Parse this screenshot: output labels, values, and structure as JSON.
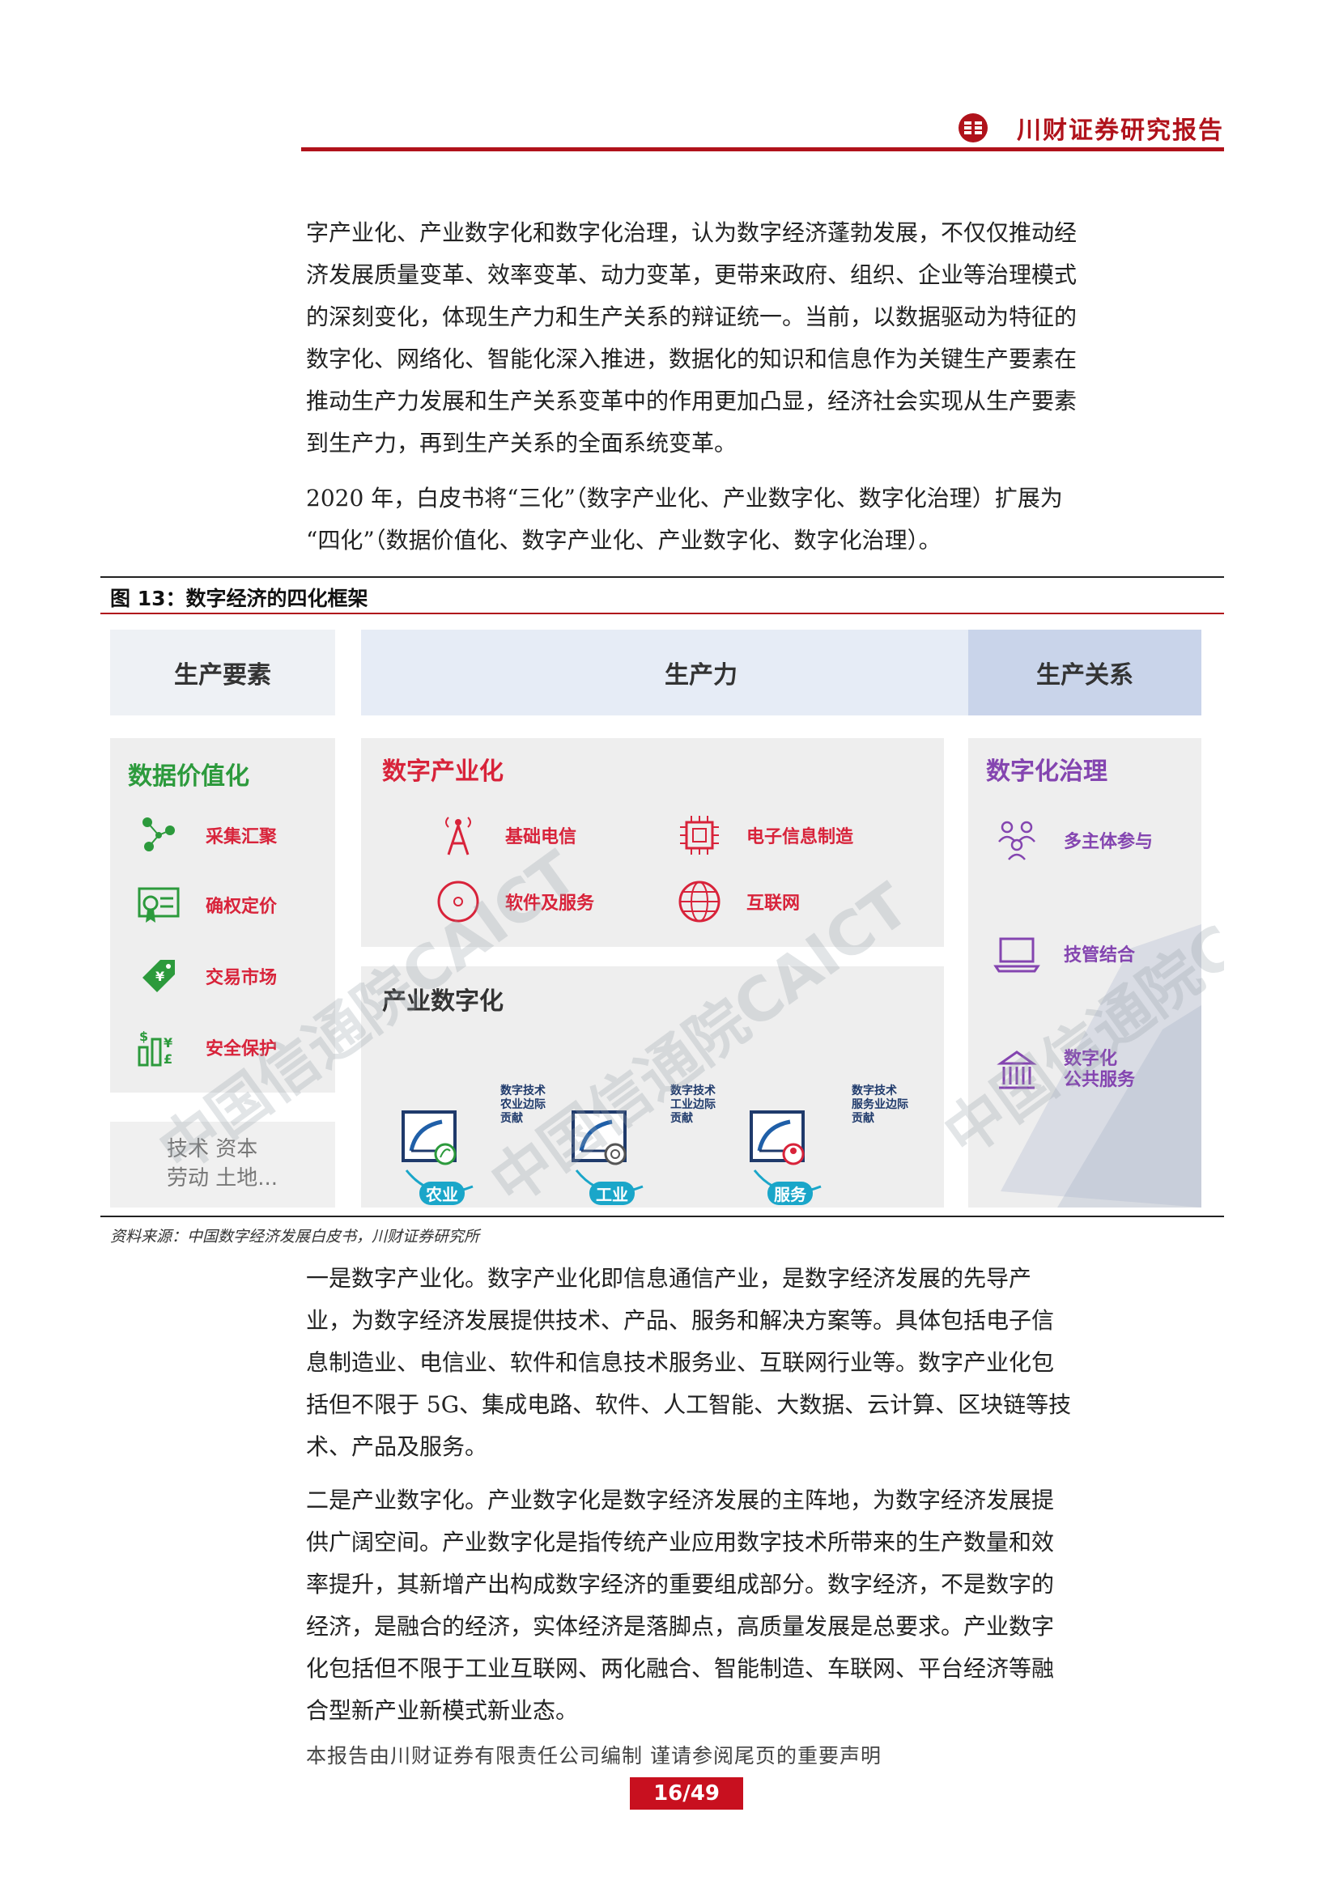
{
  "header": {
    "title": "川财证券研究报告"
  },
  "paragraphs": {
    "p1": [
      "字产业化、产业数字化和数字化治理，认为数字经济蓬勃发展，不仅仅推动经",
      "济发展质量变革、效率变革、动力变革，更带来政府、组织、企业等治理模式",
      "的深刻变化，体现生产力和生产关系的辩证统一。当前，以数据驱动为特征的",
      "数字化、网络化、智能化深入推进，数据化的知识和信息作为关键生产要素在",
      "推动生产力发展和生产关系变革中的作用更加凸显，经济社会实现从生产要素",
      "到生产力，再到生产关系的全面系统变革。"
    ],
    "p2": [
      "2020 年，白皮书将“三化”（数字产业化、产业数字化、数字化治理）扩展为",
      "“四化”（数据价值化、数字产业化、产业数字化、数字化治理）。"
    ],
    "p3": [
      "一是数字产业化。数字产业化即信息通信产业，是数字经济发展的先导产",
      "业，为数字经济发展提供技术、产品、服务和解决方案等。具体包括电子信",
      "息制造业、电信业、软件和信息技术服务业、互联网行业等。数字产业化包",
      "括但不限于 5G、集成电路、软件、人工智能、大数据、云计算、区块链等技",
      "术、产品及服务。"
    ],
    "p4": [
      "二是产业数字化。产业数字化是数字经济发展的主阵地，为数字经济发展提",
      "供广阔空间。产业数字化是指传统产业应用数字技术所带来的生产数量和效",
      "率提升，其新增产出构成数字经济的重要组成部分。数字经济，不是数字的",
      "经济，是融合的经济，实体经济是落脚点，高质量发展是总要求。产业数字",
      "化包括但不限于工业互联网、两化融合、智能制造、车联网、平台经济等融",
      "合型新产业新模式新业态。"
    ]
  },
  "figure": {
    "title": "图 13：数字经济的四化框架",
    "columns": {
      "factors": "生产要素",
      "productivity": "生产力",
      "relations": "生产关系"
    },
    "data_valorization": {
      "title": "数据价值化",
      "items": [
        "采集汇聚",
        "确权定价",
        "交易市场",
        "安全保护"
      ],
      "traditional": [
        "技术 资本",
        "劳动 土地..."
      ]
    },
    "digital_industrialization": {
      "title": "数字产业化",
      "items": [
        "基础电信",
        "电子信息制造",
        "软件及服务",
        "互联网"
      ]
    },
    "industrial_digitalization": {
      "title": "产业数字化",
      "sectors": [
        {
          "name": "农业",
          "note": [
            "数字技术",
            "农业边际",
            "贡献"
          ]
        },
        {
          "name": "工业",
          "note": [
            "数字技术",
            "工业边际",
            "贡献"
          ]
        },
        {
          "name": "服务",
          "note": [
            "数字技术",
            "服务业边际",
            "贡献"
          ]
        }
      ]
    },
    "digital_governance": {
      "title": "数字化治理",
      "items": [
        "多主体参与",
        "技管结合",
        "数字化",
        "公共服务"
      ]
    },
    "watermark": "中国信通院CAICT"
  },
  "source": "资料来源：中国数字经济发展白皮书，川财证券研究所",
  "footer": {
    "note": "本报告由川财证券有限责任公司编制  谨请参阅尾页的重要声明",
    "page": "16/49"
  },
  "colors": {
    "brand": "#b0121b",
    "red": "#d8233a",
    "green": "#2c9a3c",
    "purple": "#8445b0",
    "header_blue": "#c9d4ea"
  }
}
